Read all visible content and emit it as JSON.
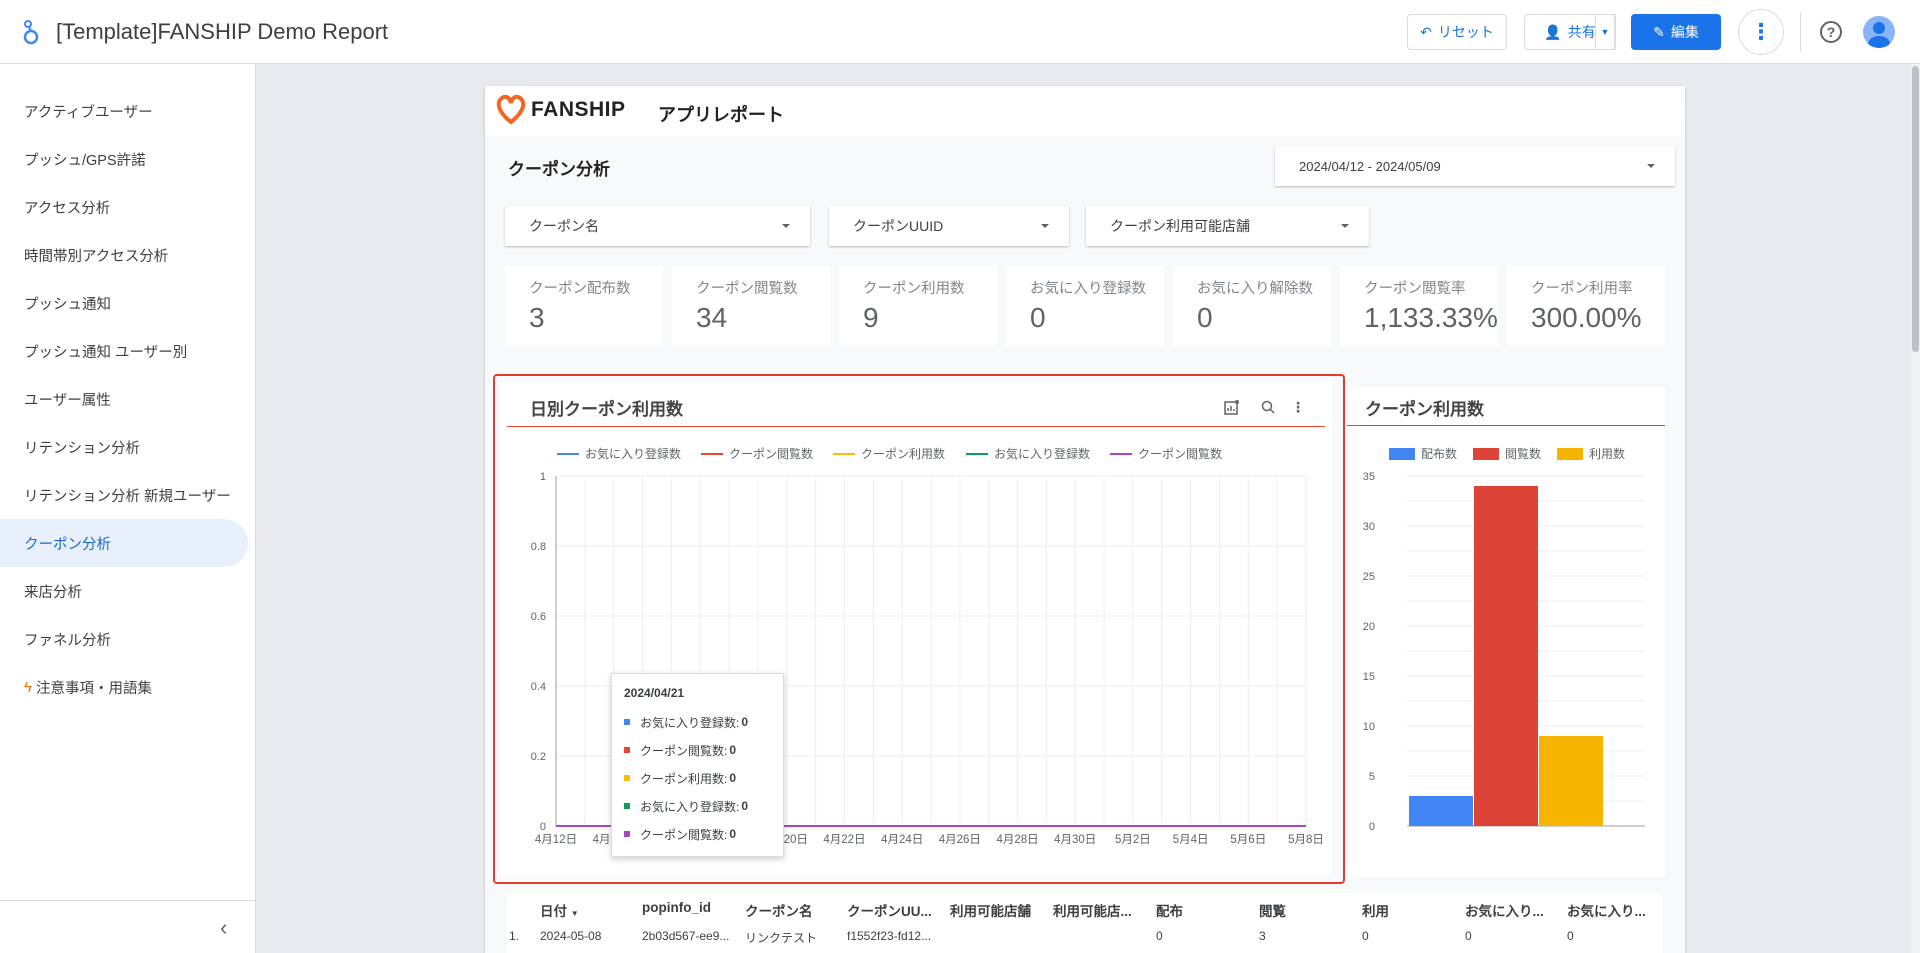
{
  "app": {
    "title": "[Template]FANSHIP Demo Report",
    "reset_label": "リセット",
    "share_label": "共有",
    "edit_label": "編集"
  },
  "sidebar": {
    "items": [
      {
        "label": "アクティブユーザー"
      },
      {
        "label": "プッシュ/GPS許諾"
      },
      {
        "label": "アクセス分析"
      },
      {
        "label": "時間帯別アクセス分析"
      },
      {
        "label": "プッシュ通知"
      },
      {
        "label": "プッシュ通知 ユーザー別"
      },
      {
        "label": "ユーザー属性"
      },
      {
        "label": "リテンション分析"
      },
      {
        "label": "リテンション分析 新規ユーザー"
      },
      {
        "label": "クーポン分析",
        "active": true
      },
      {
        "label": "来店分析"
      },
      {
        "label": "ファネル分析"
      },
      {
        "label": "注意事項・用語集",
        "icon": "lightning-icon"
      }
    ]
  },
  "report": {
    "brand": "FANSHIP",
    "subtitle": "アプリレポート",
    "section_title": "クーポン分析",
    "date_range": "2024/04/12 - 2024/05/09",
    "filters": [
      "クーポン名",
      "クーポンUUID",
      "クーポン利用可能店舗"
    ],
    "kpis": [
      {
        "label": "クーポン配布数",
        "value": "3"
      },
      {
        "label": "クーポン閲覧数",
        "value": "34"
      },
      {
        "label": "クーポン利用数",
        "value": "9"
      },
      {
        "label": "お気に入り登録数",
        "value": "0"
      },
      {
        "label": "お気に入り解除数",
        "value": "0"
      },
      {
        "label": "クーポン閲覧率",
        "value": "1,133.33%"
      },
      {
        "label": "クーポン利用率",
        "value": "300.00%"
      }
    ]
  },
  "chart_data": [
    {
      "type": "line",
      "title": "日別クーポン利用数",
      "x": [
        "4月12日",
        "4月14日",
        "4月16日",
        "4月18日",
        "4月20日",
        "4月22日",
        "4月24日",
        "4月26日",
        "4月28日",
        "4月30日",
        "5月2日",
        "5月4日",
        "5月6日",
        "5月8日"
      ],
      "ylim": [
        0,
        1
      ],
      "yticks": [
        "0",
        "0.2",
        "0.4",
        "0.6",
        "0.8",
        "1"
      ],
      "grid": true,
      "legend_position": "top",
      "series": [
        {
          "name": "お気に入り登録数",
          "color": "#4285f4",
          "values": [
            0,
            0,
            0,
            0,
            0,
            0,
            0,
            0,
            0,
            0,
            0,
            0,
            0,
            0
          ]
        },
        {
          "name": "クーポン閲覧数",
          "color": "#ea4335",
          "values": [
            0,
            0,
            0,
            0,
            0,
            0,
            0,
            0,
            0,
            0,
            0,
            0,
            0,
            0
          ]
        },
        {
          "name": "クーポン利用数",
          "color": "#fbbc04",
          "values": [
            0,
            0,
            0,
            0,
            0,
            0,
            0,
            0,
            0,
            0,
            0,
            0,
            0,
            0
          ]
        },
        {
          "name": "お気に入り登録数",
          "color": "#0f9d58",
          "values": [
            0,
            0,
            0,
            0,
            0,
            0,
            0,
            0,
            0,
            0,
            0,
            0,
            0,
            0
          ]
        },
        {
          "name": "クーポン閲覧数",
          "color": "#ab47bc",
          "values": [
            0,
            0,
            0,
            0,
            0,
            0,
            0,
            0,
            0,
            0,
            0,
            0,
            0,
            0
          ]
        }
      ],
      "tooltip": {
        "date": "2024/04/21",
        "rows": [
          {
            "name": "お気に入り登録数:",
            "value": "0",
            "color": "#4285f4"
          },
          {
            "name": "クーポン閲覧数:",
            "value": "0",
            "color": "#ea4335"
          },
          {
            "name": "クーポン利用数:",
            "value": "0",
            "color": "#fbbc04"
          },
          {
            "name": "お気に入り登録数:",
            "value": "0",
            "color": "#0f9d58"
          },
          {
            "name": "クーポン閲覧数:",
            "value": "0",
            "color": "#ab47bc"
          }
        ]
      }
    },
    {
      "type": "bar",
      "title": "クーポン利用数",
      "categories": [
        "配布数",
        "閲覧数",
        "利用数"
      ],
      "values": [
        3,
        34,
        9
      ],
      "colors": [
        "#4285f4",
        "#db4437",
        "#f4b400"
      ],
      "ylim": [
        0,
        35
      ],
      "yticks": [
        "0",
        "5",
        "10",
        "15",
        "20",
        "25",
        "30",
        "35"
      ],
      "grid": true,
      "legend_position": "top"
    }
  ],
  "table": {
    "headers": [
      "日付",
      "popinfo_id",
      "クーポン名",
      "クーポンUU...",
      "利用可能店舗",
      "利用可能店...",
      "配布",
      "閲覧",
      "利用",
      "お気に入り...",
      "お気に入り..."
    ],
    "rows": [
      {
        "index": "1.",
        "cells": [
          "2024-05-08",
          "2b03d567-ee9...",
          "リンクテスト",
          "f1552f23-fd12...",
          "",
          "",
          "0",
          "3",
          "0",
          "0",
          "0"
        ]
      }
    ]
  }
}
